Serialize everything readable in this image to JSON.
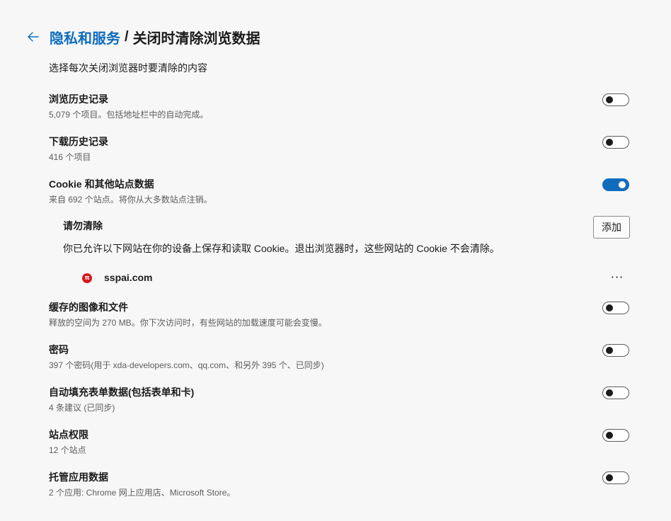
{
  "header": {
    "back_icon": "arrow-left-icon",
    "parent": "隐私和服务",
    "separator": "/",
    "current": "关闭时清除浏览数据"
  },
  "subtitle": "选择每次关闭浏览器时要清除的内容",
  "items": [
    {
      "title": "浏览历史记录",
      "desc": "5,079 个项目。包括地址栏中的自动完成。",
      "enabled": false
    },
    {
      "title": "下载历史记录",
      "desc": "416 个项目",
      "enabled": false
    },
    {
      "title": "Cookie 和其他站点数据",
      "desc": "来自 692 个站点。将你从大多数站点注销。",
      "enabled": true
    },
    {
      "title": "缓存的图像和文件",
      "desc": "释放的空间为 270 MB。你下次访问时，有些网站的加载速度可能会变慢。",
      "enabled": false
    },
    {
      "title": "密码",
      "desc": "397 个密码(用于 xda-developers.com、qq.com、和另外 395 个、已同步)",
      "enabled": false
    },
    {
      "title": "自动填充表单数据(包括表单和卡)",
      "desc": "4 条建议 (已同步)",
      "enabled": false
    },
    {
      "title": "站点权限",
      "desc": "12 个站点",
      "enabled": false
    },
    {
      "title": "托管应用数据",
      "desc": "2 个应用: Chrome 网上应用店、Microsoft Store。",
      "enabled": false
    }
  ],
  "do_not_clear": {
    "title": "请勿清除",
    "desc": "你已允许以下网站在你的设备上保存和读取 Cookie。退出浏览器时，这些网站的 Cookie 不会清除。",
    "add_label": "添加",
    "sites": [
      {
        "name": "sspai.com",
        "icon_glyph": "π",
        "icon_color": "#d7191f",
        "more_label": "···"
      }
    ]
  },
  "colors": {
    "accent": "#0f6cbd",
    "background": "#f7f7f7"
  }
}
